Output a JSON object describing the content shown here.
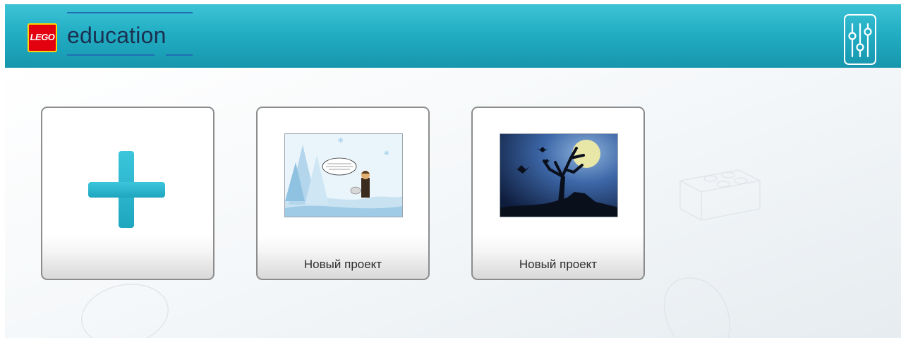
{
  "header": {
    "logo_text": "LEGO",
    "brand_text": "education"
  },
  "icons": {
    "settings": "sliders-icon",
    "new_project": "plus-icon"
  },
  "projects": [
    {
      "title": "Новый проект",
      "thumbnail": "winter-comic-scene"
    },
    {
      "title": "Новый проект",
      "thumbnail": "halloween-night-tree"
    }
  ],
  "colors": {
    "header_accent": "#22aec4",
    "plus": "#29b8d0",
    "logo_red": "#e3000f",
    "logo_yellow": "#ffd500",
    "brand_text": "#1b3050"
  }
}
